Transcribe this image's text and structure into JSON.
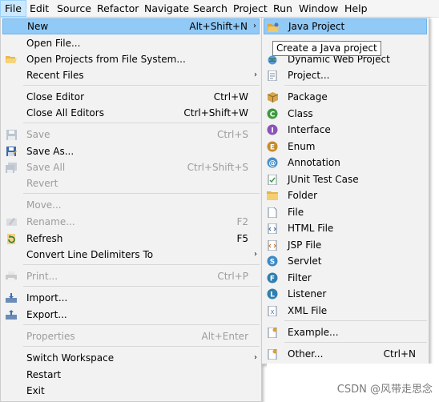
{
  "menubar": {
    "items": [
      "File",
      "Edit",
      "Source",
      "Refactor",
      "Navigate",
      "Search",
      "Project",
      "Run",
      "Window",
      "Help"
    ]
  },
  "file_menu": {
    "new": {
      "label": "New",
      "shortcut": "Alt+Shift+N"
    },
    "open_file": {
      "label": "Open File..."
    },
    "open_projects": {
      "label": "Open Projects from File System..."
    },
    "recent_files": {
      "label": "Recent Files"
    },
    "close_editor": {
      "label": "Close Editor",
      "shortcut": "Ctrl+W"
    },
    "close_all_editors": {
      "label": "Close All Editors",
      "shortcut": "Ctrl+Shift+W"
    },
    "save": {
      "label": "Save",
      "shortcut": "Ctrl+S"
    },
    "save_as": {
      "label": "Save As..."
    },
    "save_all": {
      "label": "Save All",
      "shortcut": "Ctrl+Shift+S"
    },
    "revert": {
      "label": "Revert"
    },
    "move": {
      "label": "Move..."
    },
    "rename": {
      "label": "Rename...",
      "shortcut": "F2"
    },
    "refresh": {
      "label": "Refresh",
      "shortcut": "F5"
    },
    "convert_line_delimiters": {
      "label": "Convert Line Delimiters To"
    },
    "print": {
      "label": "Print...",
      "shortcut": "Ctrl+P"
    },
    "import": {
      "label": "Import..."
    },
    "export": {
      "label": "Export..."
    },
    "properties": {
      "label": "Properties",
      "shortcut": "Alt+Enter"
    },
    "switch_workspace": {
      "label": "Switch Workspace"
    },
    "restart": {
      "label": "Restart"
    },
    "exit": {
      "label": "Exit"
    }
  },
  "new_submenu": {
    "java_project": {
      "label": "Java Project"
    },
    "dynamic_web_project": {
      "label": "Dynamic Web Project"
    },
    "project": {
      "label": "Project..."
    },
    "package": {
      "label": "Package"
    },
    "class": {
      "label": "Class"
    },
    "interface": {
      "label": "Interface"
    },
    "enum": {
      "label": "Enum"
    },
    "annotation": {
      "label": "Annotation"
    },
    "junit_test_case": {
      "label": "JUnit Test Case"
    },
    "folder": {
      "label": "Folder"
    },
    "file": {
      "label": "File"
    },
    "html_file": {
      "label": "HTML File"
    },
    "jsp_file": {
      "label": "JSP File"
    },
    "servlet": {
      "label": "Servlet"
    },
    "filter": {
      "label": "Filter"
    },
    "listener": {
      "label": "Listener"
    },
    "xml_file": {
      "label": "XML File"
    },
    "example": {
      "label": "Example..."
    },
    "other": {
      "label": "Other...",
      "shortcut": "Ctrl+N"
    }
  },
  "tooltip": "Create a Java project",
  "watermark": "CSDN @风带走思念",
  "colors": {
    "menu_bg": "#f2f2f2",
    "highlight": "#91c9f7",
    "menubar_active": "#cce8ff",
    "disabled_text": "#9c9c9c"
  }
}
